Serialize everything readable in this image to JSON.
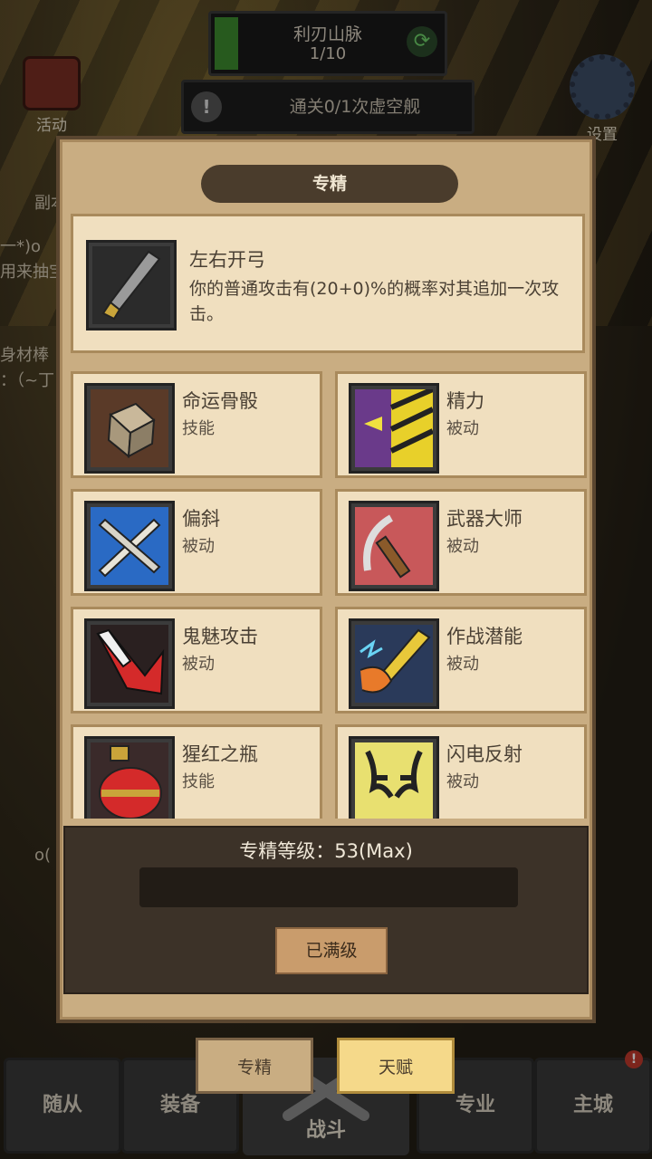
{
  "header": {
    "stage_name": "利刃山脉",
    "stage_count": "1/10",
    "quest_text": "通关0/1次虚空舰",
    "quest_alert": "!",
    "activity_label": "活动",
    "settings_label": "设置",
    "side_peek": [
      "副本",
      "一*)o",
      "用来抽宝",
      "身材棒",
      "：（~丁",
      "o("
    ]
  },
  "modal": {
    "title": "专精",
    "featured": {
      "name": "左右开弓",
      "description": "你的普通攻击有(20+0)%的概率对其追加一次攻击。",
      "icon": "twin-blade-icon"
    },
    "skills": [
      {
        "name": "命运骨骰",
        "type": "技能",
        "icon": "fate-dice-icon"
      },
      {
        "name": "精力",
        "type": "被动",
        "icon": "vigor-icon"
      },
      {
        "name": "偏斜",
        "type": "被动",
        "icon": "deflect-icon"
      },
      {
        "name": "武器大师",
        "type": "被动",
        "icon": "weapon-master-icon"
      },
      {
        "name": "鬼魅攻击",
        "type": "被动",
        "icon": "phantom-strike-icon"
      },
      {
        "name": "作战潜能",
        "type": "被动",
        "icon": "combat-potential-icon"
      },
      {
        "name": "猩红之瓶",
        "type": "技能",
        "icon": "crimson-flask-icon"
      },
      {
        "name": "闪电反射",
        "type": "被动",
        "icon": "lightning-reflex-icon"
      }
    ],
    "level_label": "专精等级：53(Max)",
    "maxed_button": "已满级"
  },
  "tabs": {
    "spec": "专精",
    "talent": "天赋"
  },
  "bottom_nav": {
    "items": [
      "随从",
      "装备",
      "专业",
      "主城"
    ],
    "battle": "战斗",
    "badge": "!"
  },
  "colors": {
    "panel": "#c9ad82",
    "card": "#f0dfbf",
    "card_border": "#a98a5c",
    "title_bar": "#4a3c2c",
    "talent_tab": "#f5d98a"
  }
}
